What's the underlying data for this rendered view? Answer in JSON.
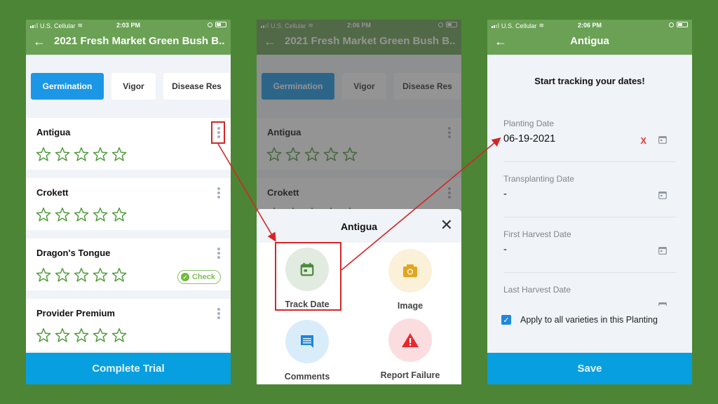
{
  "screen1": {
    "status": {
      "carrier": "U.S. Cellular",
      "time": "2:03 PM"
    },
    "title": "2021 Fresh Market Green Bush B...",
    "tabs": [
      {
        "label": "Germination",
        "active": true
      },
      {
        "label": "Vigor",
        "active": false
      },
      {
        "label": "Disease Res",
        "active": false
      }
    ],
    "varieties": [
      {
        "name": "Antigua",
        "stars": 0,
        "max_stars": 5
      },
      {
        "name": "Crokett",
        "stars": 0,
        "max_stars": 5
      },
      {
        "name": "Dragon's Tongue",
        "stars": 0,
        "max_stars": 5,
        "badge": "Check"
      },
      {
        "name": "Provider Premium",
        "stars": 0,
        "max_stars": 5
      }
    ],
    "complete_button": "Complete Trial"
  },
  "screen2": {
    "status": {
      "carrier": "U.S. Cellular",
      "time": "2:06 PM"
    },
    "title": "2021 Fresh Market Green Bush B...",
    "tabs": [
      {
        "label": "Germination",
        "active": true
      },
      {
        "label": "Vigor",
        "active": false
      },
      {
        "label": "Disease Res",
        "active": false
      }
    ],
    "varieties": [
      {
        "name": "Antigua",
        "stars": 0,
        "max_stars": 5
      },
      {
        "name": "Crokett",
        "stars": 0,
        "max_stars": 5
      }
    ],
    "sheet": {
      "title": "Antigua",
      "actions": [
        {
          "label": "Track Date",
          "icon": "calendar-icon",
          "bg": "#e2ebdf",
          "color": "#4c8a3d"
        },
        {
          "label": "Image",
          "icon": "camera-icon",
          "bg": "#fbf0d8",
          "color": "#e2a520"
        },
        {
          "label": "Comments",
          "icon": "comment-icon",
          "bg": "#d9ecfa",
          "color": "#1b86d9"
        },
        {
          "label": "Report Failure",
          "icon": "warning-icon",
          "bg": "#fbdde0",
          "color": "#e8282d"
        }
      ]
    }
  },
  "screen3": {
    "status": {
      "carrier": "U.S. Cellular",
      "time": "2:06 PM"
    },
    "title": "Antigua",
    "heading": "Start tracking your dates!",
    "fields": [
      {
        "label": "Planting Date",
        "value": "06-19-2021",
        "clear": "X"
      },
      {
        "label": "Transplanting Date",
        "value": "-"
      },
      {
        "label": "First Harvest Date",
        "value": "-"
      },
      {
        "label": "Last Harvest Date",
        "value": ""
      }
    ],
    "apply_all": {
      "label": "Apply to all varieties in this Planting",
      "checked": true
    },
    "save_button": "Save"
  },
  "colors": {
    "background": "#4c8535",
    "appbar": "#6aa154",
    "primary_button": "#079fe0",
    "active_tab": "#1b97e6",
    "star": "#4f9a3c",
    "annotation": "#d42626"
  }
}
